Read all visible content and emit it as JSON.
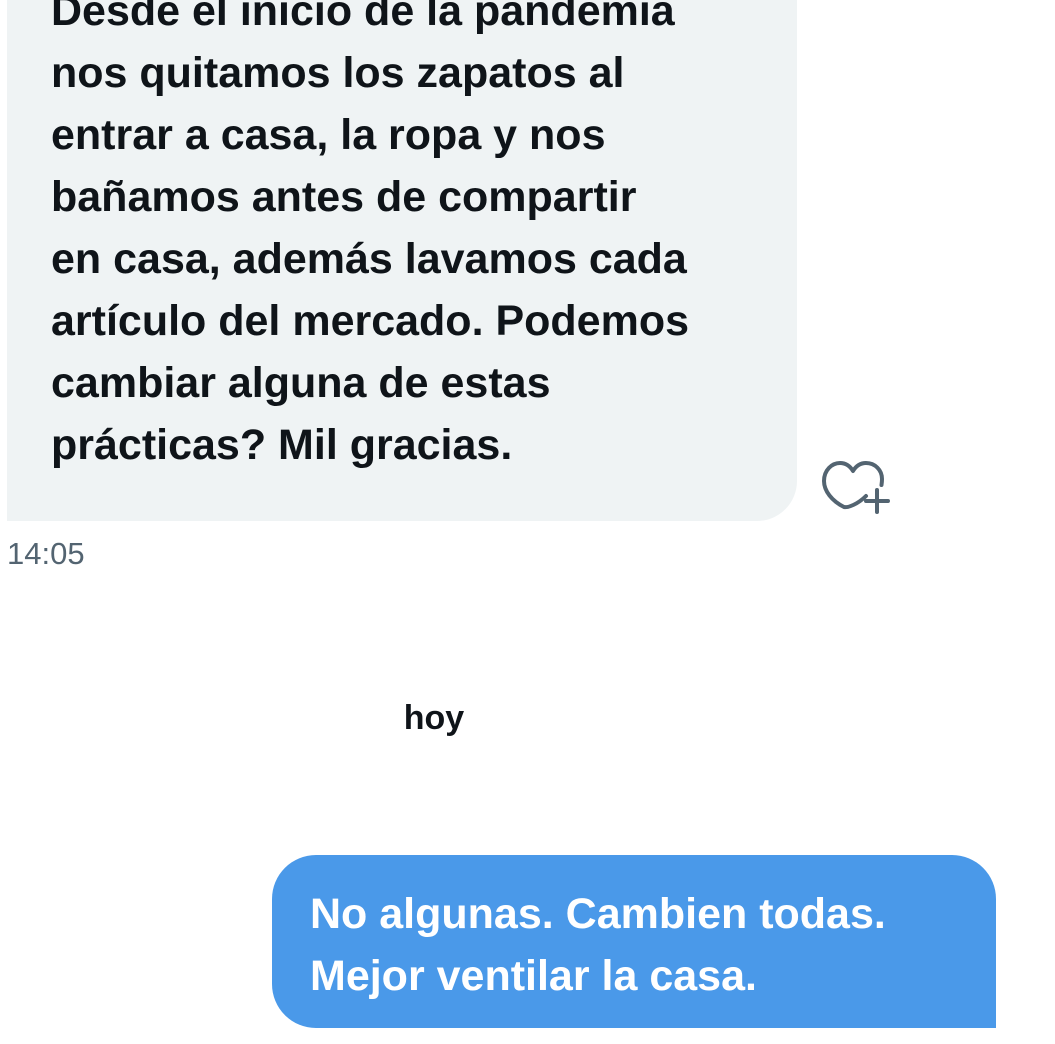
{
  "incoming_message": {
    "text": "Desde el inicio de la pandemia\nnos quitamos los zapatos al\nentrar a casa, la ropa y nos\nbañamos antes de compartir\nen casa, además lavamos cada\nartículo del mercado. Podemos\ncambiar alguna de estas\nprácticas? Mil gracias.",
    "time": "14:05",
    "reaction_icon": "heart-plus-icon"
  },
  "day_separator": "hoy",
  "outgoing_message": {
    "text": "No algunas. Cambien todas.\nMejor ventilar la casa."
  },
  "colors": {
    "incoming_bg": "#eff3f4",
    "outgoing_bg": "#4a99e9",
    "timestamp": "#536471",
    "text": "#0f1419",
    "icon": "#536471"
  }
}
